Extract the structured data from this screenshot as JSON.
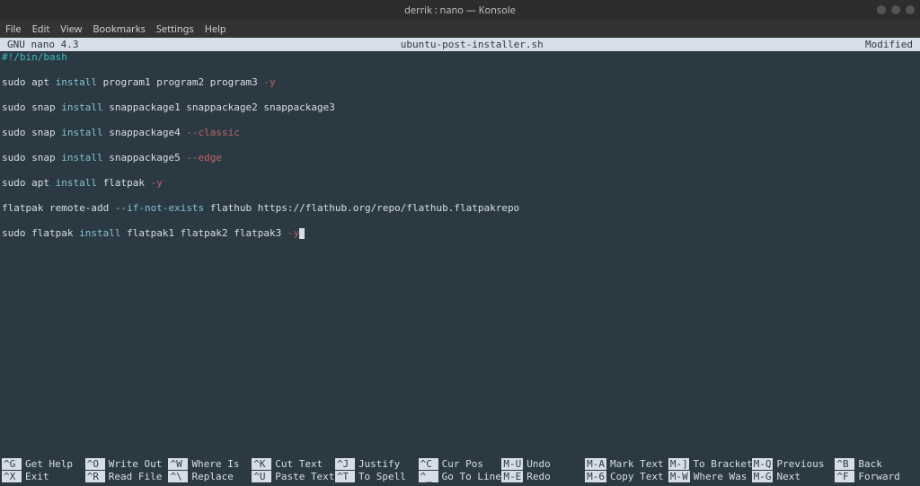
{
  "window": {
    "title": "derrik : nano — Konsole"
  },
  "menubar": {
    "items": [
      "File",
      "Edit",
      "View",
      "Bookmarks",
      "Settings",
      "Help"
    ]
  },
  "nano": {
    "version": "GNU nano 4.3",
    "filename": "ubuntu-post-installer.sh",
    "status": "Modified",
    "lines": [
      {
        "type": "shebang",
        "raw": "#!/bin/bash"
      },
      {
        "type": "blank"
      },
      {
        "type": "apt",
        "parts": [
          "sudo apt ",
          "install",
          " program1 program2 program3 ",
          "-y"
        ]
      },
      {
        "type": "blank"
      },
      {
        "type": "snap",
        "parts": [
          "sudo snap ",
          "install",
          " snappackage1 snappackage2 snappackage3"
        ]
      },
      {
        "type": "blank"
      },
      {
        "type": "snap",
        "parts": [
          "sudo snap ",
          "install",
          " snappackage4 ",
          "--classic"
        ]
      },
      {
        "type": "blank"
      },
      {
        "type": "snap",
        "parts": [
          "sudo snap ",
          "install",
          " snappackage5 ",
          "--edge"
        ]
      },
      {
        "type": "blank"
      },
      {
        "type": "apt",
        "parts": [
          "sudo apt ",
          "install",
          " flatpak ",
          "-y"
        ]
      },
      {
        "type": "blank"
      },
      {
        "type": "flatpak",
        "parts": [
          "flatpak remote-add ",
          "--if-not-exists",
          " flathub https://flathub.org/repo/flathub.flatpakrepo"
        ]
      },
      {
        "type": "blank"
      },
      {
        "type": "flatpak",
        "parts": [
          "sudo flatpak ",
          "install",
          " flatpak1 flatpak2 flatpak3 ",
          "-y"
        ],
        "cursor": true
      }
    ],
    "help_rows": [
      [
        {
          "key": "^G",
          "label": "Get Help"
        },
        {
          "key": "^O",
          "label": "Write Out"
        },
        {
          "key": "^W",
          "label": "Where Is"
        },
        {
          "key": "^K",
          "label": "Cut Text"
        },
        {
          "key": "^J",
          "label": "Justify"
        },
        {
          "key": "^C",
          "label": "Cur Pos"
        },
        {
          "key": "M-U",
          "label": "Undo"
        },
        {
          "key": "M-A",
          "label": "Mark Text"
        },
        {
          "key": "M-]",
          "label": "To Bracket"
        },
        {
          "key": "M-Q",
          "label": "Previous"
        },
        {
          "key": "^B",
          "label": "Back"
        }
      ],
      [
        {
          "key": "^X",
          "label": "Exit"
        },
        {
          "key": "^R",
          "label": "Read File"
        },
        {
          "key": "^\\",
          "label": "Replace"
        },
        {
          "key": "^U",
          "label": "Paste Text"
        },
        {
          "key": "^T",
          "label": "To Spell"
        },
        {
          "key": "^_",
          "label": "Go To Line"
        },
        {
          "key": "M-E",
          "label": "Redo"
        },
        {
          "key": "M-6",
          "label": "Copy Text"
        },
        {
          "key": "M-W",
          "label": "Where Was"
        },
        {
          "key": "M-G",
          "label": "Next"
        },
        {
          "key": "^F",
          "label": "Forward"
        }
      ]
    ]
  }
}
